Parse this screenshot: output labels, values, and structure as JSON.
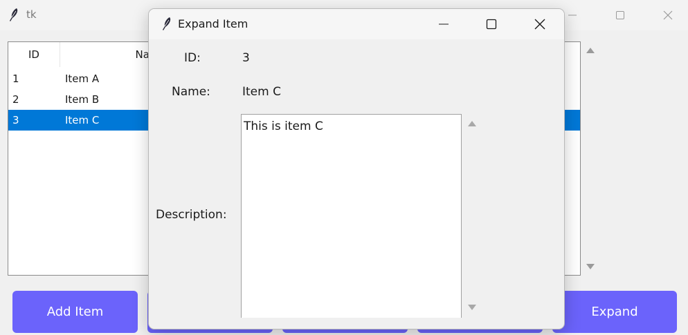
{
  "main_window": {
    "title": "tk",
    "tree": {
      "columns": [
        "ID",
        "Nam"
      ],
      "rows": [
        {
          "id": "1",
          "name": "Item A",
          "selected": false
        },
        {
          "id": "2",
          "name": "Item B",
          "selected": false
        },
        {
          "id": "3",
          "name": "Item C",
          "selected": true
        }
      ]
    },
    "buttons": {
      "add_label": "Add Item",
      "expand_label": "Expand"
    }
  },
  "dialog": {
    "title": "Expand Item",
    "id_label": "ID:",
    "id_value": "3",
    "name_label": "Name:",
    "name_value": "Item C",
    "description_label": "Description:",
    "description_value": "This is item C"
  },
  "colors": {
    "button_bg": "#6b63fb",
    "selection": "#0078d7",
    "window_bg": "#f0f0f0"
  },
  "icons": {
    "app": "feather-icon",
    "minimize": "minimize-icon",
    "maximize": "maximize-icon",
    "close": "close-icon"
  }
}
